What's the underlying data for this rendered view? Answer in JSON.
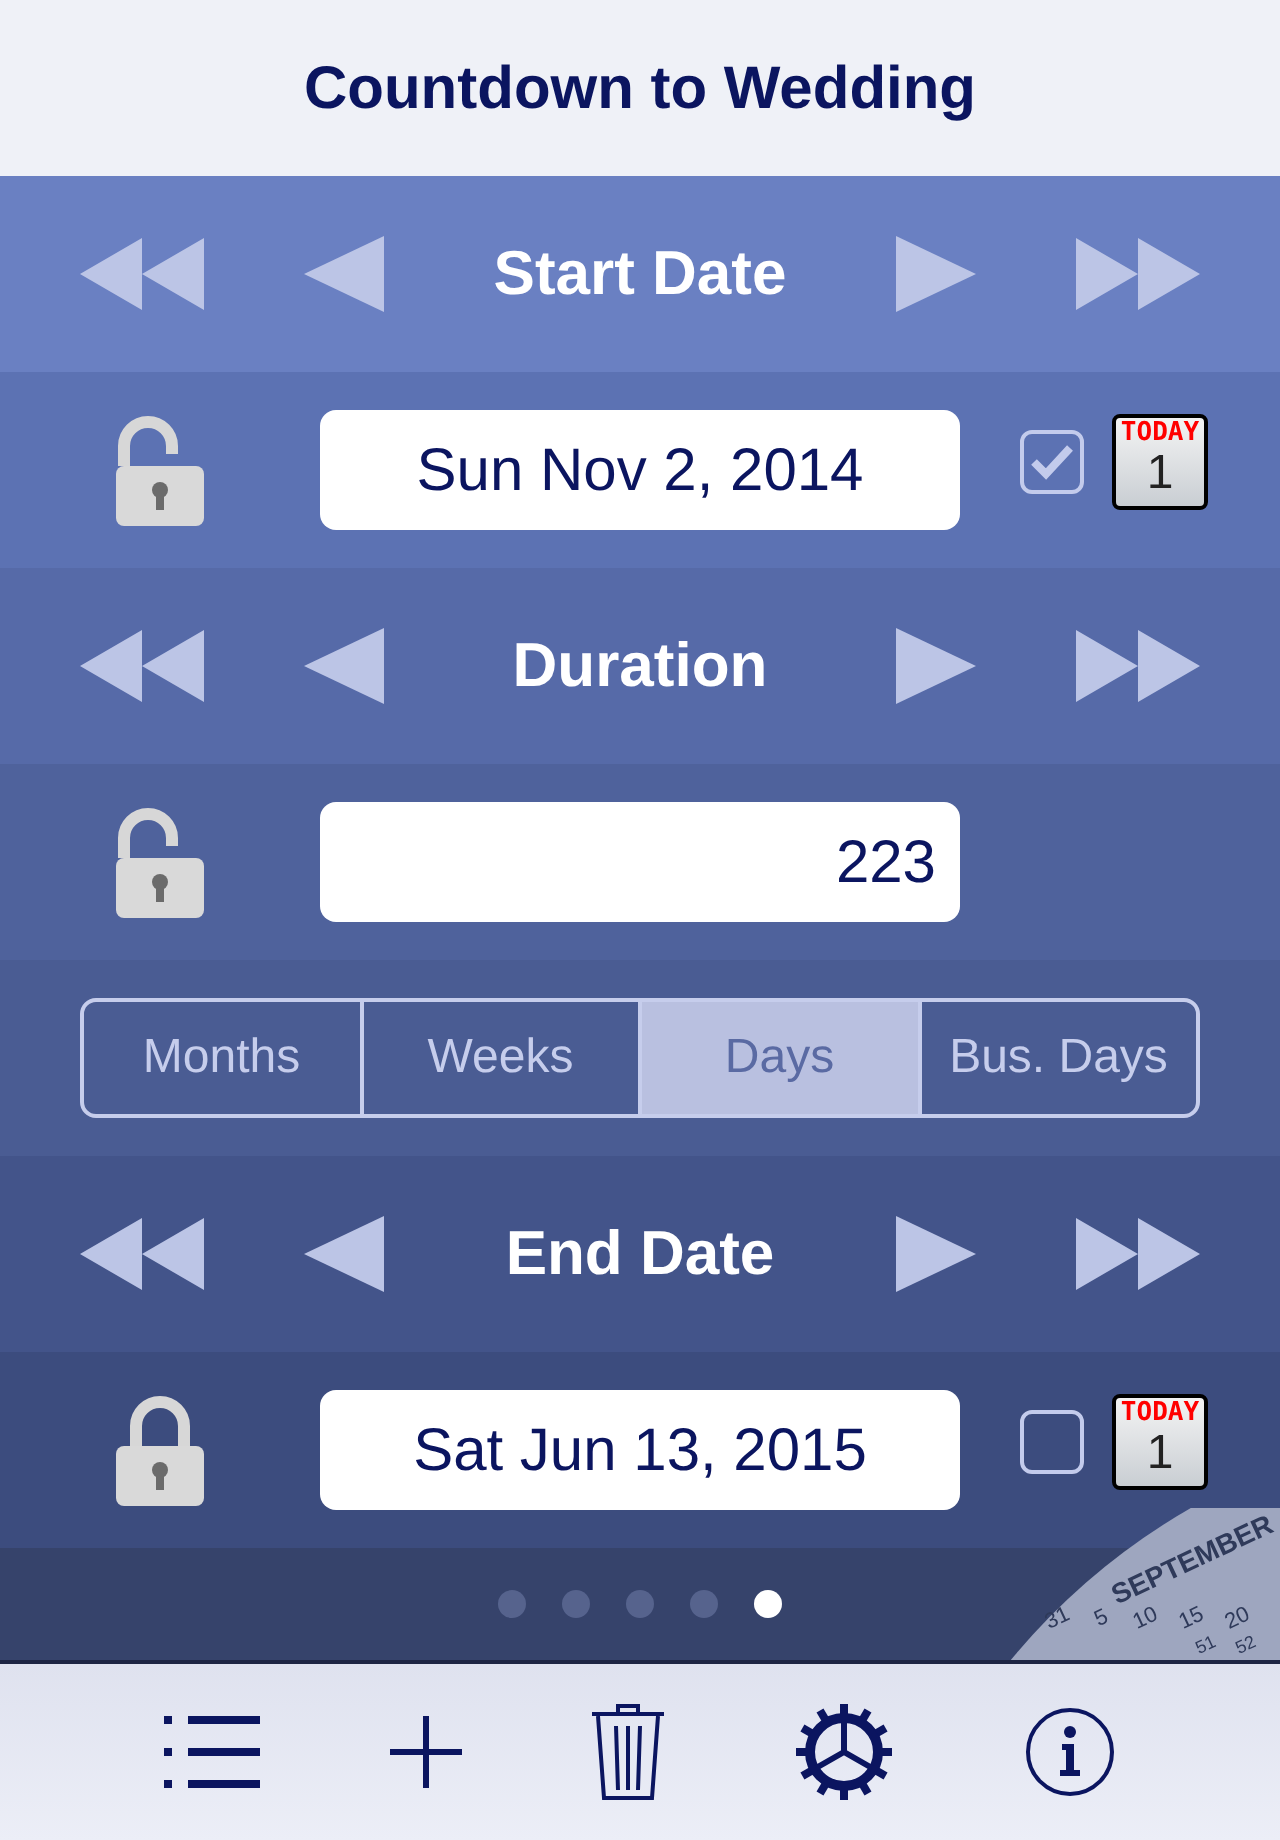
{
  "title": "Countdown to Wedding",
  "sections": [
    {
      "kind": "nav",
      "title": "Start Date"
    },
    {
      "kind": "date",
      "locked": false,
      "value": "Sun Nov 2, 2014",
      "checked": true,
      "today": {
        "label": "TODAY",
        "day": "1"
      }
    },
    {
      "kind": "nav",
      "title": "Duration"
    },
    {
      "kind": "number",
      "locked": false,
      "value": "223"
    },
    {
      "kind": "segments",
      "options": [
        {
          "label": "Months",
          "selected": false
        },
        {
          "label": "Weeks",
          "selected": false
        },
        {
          "label": "Days",
          "selected": true
        },
        {
          "label": "Bus. Days",
          "selected": false
        }
      ]
    },
    {
      "kind": "nav",
      "title": "End Date"
    },
    {
      "kind": "date",
      "locked": true,
      "value": "Sat Jun 13, 2015",
      "checked": false,
      "today": {
        "label": "TODAY",
        "day": "1"
      }
    }
  ],
  "pages": [
    {
      "selected": false
    },
    {
      "selected": false
    },
    {
      "selected": false
    },
    {
      "selected": false
    },
    {
      "selected": true
    }
  ],
  "dial": {
    "month": "SEPTEMBER",
    "days": [
      "31",
      "5",
      "10",
      "15",
      "20"
    ],
    "weeks": [
      "51",
      "52"
    ]
  },
  "toolbar": [
    {
      "kind": "list"
    },
    {
      "kind": "add"
    },
    {
      "kind": "trash"
    },
    {
      "kind": "settings"
    },
    {
      "kind": "info"
    }
  ]
}
